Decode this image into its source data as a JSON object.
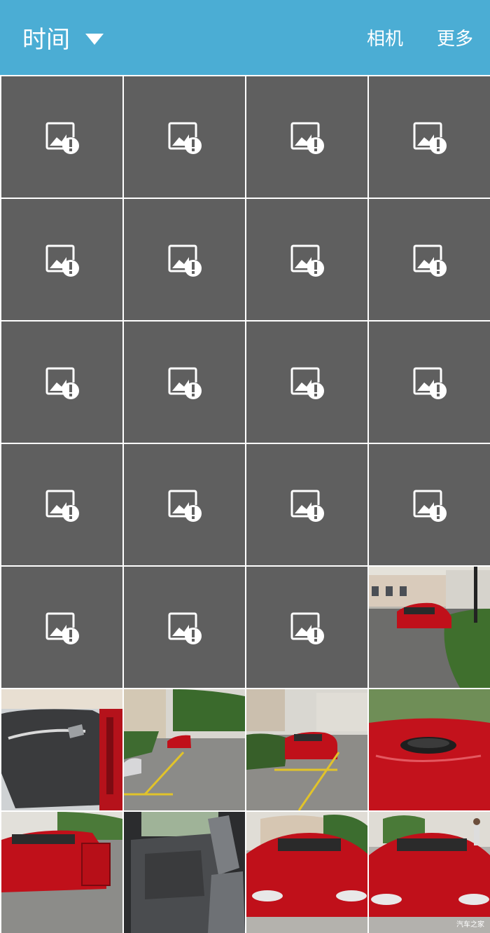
{
  "header": {
    "title": "时间",
    "camera_label": "相机",
    "more_label": "更多"
  },
  "grid": {
    "broken_count": 19,
    "photo_count": 9
  },
  "watermark": "汽车之家",
  "colors": {
    "topbar": "#4badd4",
    "broken_tile": "#5f5f5f",
    "car_red": "#c0101a"
  },
  "icons": {
    "broken": "broken-image-icon",
    "dropdown": "chevron-down-icon"
  }
}
